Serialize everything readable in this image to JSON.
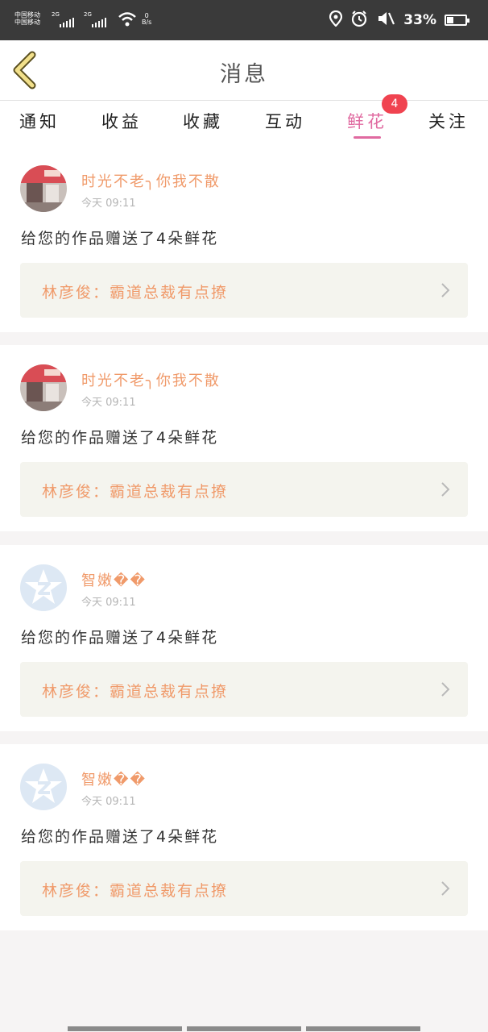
{
  "status_bar": {
    "carrier_1": "中国移动",
    "carrier_2": "中国移动",
    "net_1": "2G",
    "net_2": "2G",
    "speed_value": "0",
    "speed_unit": "B/s",
    "battery_percent": "33%",
    "icons": [
      "location-icon",
      "alarm-icon",
      "mute-icon",
      "battery-icon"
    ]
  },
  "header": {
    "title": "消息",
    "back_icon": "chevron-left-icon"
  },
  "tabs": [
    {
      "label": "通知",
      "active": false
    },
    {
      "label": "收益",
      "active": false
    },
    {
      "label": "收藏",
      "active": false
    },
    {
      "label": "互动",
      "active": false
    },
    {
      "label": "鲜花",
      "active": true
    },
    {
      "label": "关注",
      "active": false
    }
  ],
  "flower_badge": "4",
  "colors": {
    "accent": "#e06aa0",
    "username": "#f09a6a",
    "badge": "#f04350",
    "link_bg": "#f4f4ee"
  },
  "messages": [
    {
      "username": "时光不老╮你我不散",
      "time": "今天 09:11",
      "text": "给您的作品赠送了4朵鲜花",
      "work": "林彦俊：霸道总裁有点撩",
      "avatar": "photo"
    },
    {
      "username": "时光不老╮你我不散",
      "time": "今天 09:11",
      "text": "给您的作品赠送了4朵鲜花",
      "work": "林彦俊：霸道总裁有点撩",
      "avatar": "photo"
    },
    {
      "username": "智嫩��",
      "time": "今天 09:11",
      "text": "给您的作品赠送了4朵鲜花",
      "work": "林彦俊：霸道总裁有点撩",
      "avatar": "default"
    },
    {
      "username": "智嫩��",
      "time": "今天 09:11",
      "text": "给您的作品赠送了4朵鲜花",
      "work": "林彦俊：霸道总裁有点撩",
      "avatar": "default"
    }
  ]
}
